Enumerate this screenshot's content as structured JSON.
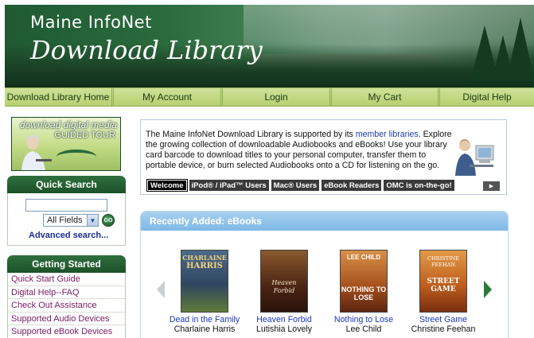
{
  "header": {
    "line1": "Maine InfoNet",
    "line2": "Download Library"
  },
  "nav": {
    "items": [
      {
        "label": "Download Library Home"
      },
      {
        "label": "My Account"
      },
      {
        "label": "Login"
      },
      {
        "label": "My Cart"
      },
      {
        "label": "Digital Help"
      }
    ]
  },
  "tour_banner": {
    "line1": "download digital media",
    "line2": "GUIDED TOUR"
  },
  "quick_search": {
    "heading": "Quick Search",
    "input_value": "",
    "field_select": "All Fields",
    "go_label": "GO",
    "advanced_link": "Advanced search..."
  },
  "getting_started": {
    "heading": "Getting Started",
    "items": [
      {
        "label": "Quick Start Guide"
      },
      {
        "label": "Digital Help--FAQ"
      },
      {
        "label": "Check Out Assistance"
      },
      {
        "label": "Supported Audio Devices"
      },
      {
        "label": "Supported eBook Devices"
      }
    ]
  },
  "info": {
    "text_before_link": "The Maine InfoNet Download Library is supported by its ",
    "link": "member libraries",
    "text_after_link": ". Explore the growing collection of downloadable Audiobooks and eBooks! Use your library card barcode to download titles to your personal computer, transfer them to portable device, or burn selected Audiobooks onto a CD for listening on the go.",
    "tabs": [
      {
        "label": "Welcome"
      },
      {
        "label": "iPod® / iPad™ Users"
      },
      {
        "label": "Mac® Users"
      },
      {
        "label": "eBook Readers"
      },
      {
        "label": "OMC is on-the-go!"
      }
    ],
    "play_icon": "play-icon"
  },
  "recent": {
    "heading": "Recently Added: eBooks",
    "books": [
      {
        "title": "Dead in the Family",
        "author": "Charlaine Harris",
        "cover_line1": "CHARLAINE",
        "cover_line2": "HARRIS",
        "cover_color": "#3f5a78"
      },
      {
        "title": "Heaven Forbid",
        "author": "Lutishia Lovely",
        "cover_line1": "Heaven",
        "cover_line2": "Forbid",
        "cover_color": "#6b3a22"
      },
      {
        "title": "Nothing to Lose",
        "author": "Lee Child",
        "cover_line1": "LEE CHILD",
        "cover_line2": "NOTHING TO LOSE",
        "cover_color": "#b8672a"
      },
      {
        "title": "Street Game",
        "author": "Christine Feehan",
        "cover_line1": "CHRISTINE FEEHAN",
        "cover_line2": "STREET GAME",
        "cover_color": "#c86b24"
      }
    ]
  }
}
